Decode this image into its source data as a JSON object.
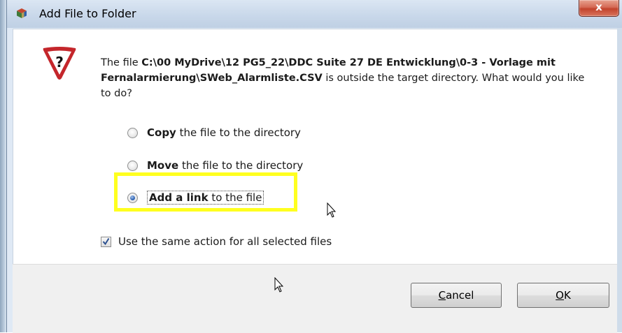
{
  "window": {
    "title": "Add File to Folder",
    "close_label": "x"
  },
  "message": {
    "prefix": "The file ",
    "path": "C:\\00 MyDrive\\12 PG5_22\\DDC Suite 27 DE Entwicklung\\0-3 - Vorlage mit Fernalarmierung\\SWeb_Alarmliste.CSV",
    "suffix": " is outside the target directory. What would you like to do?"
  },
  "options": [
    {
      "bold": "Copy",
      "rest": " the file to the directory",
      "selected": false
    },
    {
      "bold": "Move",
      "rest": " the file to the directory",
      "selected": false
    },
    {
      "bold": "Add a link",
      "rest": " to the file",
      "selected": true
    }
  ],
  "same_action": {
    "label": "Use the same action for all selected files",
    "checked": true
  },
  "buttons": {
    "cancel_first": "C",
    "cancel_rest": "ancel",
    "ok_first": "O",
    "ok_rest": "K"
  },
  "icons": {
    "app": "app-cube-icon",
    "warning": "question-warning-icon",
    "cursor": "mouse-cursor-icon"
  },
  "colors": {
    "highlight": "#ffff1f",
    "warning_red": "#c4262b",
    "close_red": "#c2432c"
  }
}
